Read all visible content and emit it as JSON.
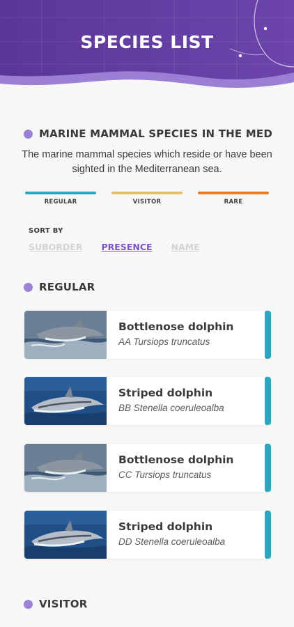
{
  "header": {
    "title": "SPECIES LIST",
    "bg_color": "#6a42a8"
  },
  "intro": {
    "heading": "MARINE MAMMAL SPECIES IN THE MED",
    "description": "The marine mammal species which reside or have been sighted in the Mediterranean sea."
  },
  "legend": [
    {
      "label": "REGULAR",
      "color": "#2aa6bf"
    },
    {
      "label": "VISITOR",
      "color": "#e5bf6a"
    },
    {
      "label": "RARE",
      "color": "#ec7a21"
    }
  ],
  "sort": {
    "label": "SORT BY",
    "options": [
      {
        "label": "SUBORDER",
        "active": false
      },
      {
        "label": "PRESENCE",
        "active": true
      },
      {
        "label": "NAME",
        "active": false
      }
    ]
  },
  "sections": [
    {
      "title": "REGULAR",
      "strip_color": "#2aa6bf",
      "species": [
        {
          "name": "Bottlenose dolphin",
          "latin": "AA Tursiops truncatus",
          "image": "bottlenose-dolphin-photo"
        },
        {
          "name": "Striped dolphin",
          "latin": "BB Stenella coeruleoalba",
          "image": "striped-dolphin-photo"
        },
        {
          "name": "Bottlenose dolphin",
          "latin": "CC Tursiops truncatus",
          "image": "bottlenose-dolphin-photo"
        },
        {
          "name": "Striped dolphin",
          "latin": "DD Stenella coeruleoalba",
          "image": "striped-dolphin-photo"
        }
      ]
    },
    {
      "title": "VISITOR",
      "strip_color": "#e5bf6a",
      "species": []
    }
  ]
}
